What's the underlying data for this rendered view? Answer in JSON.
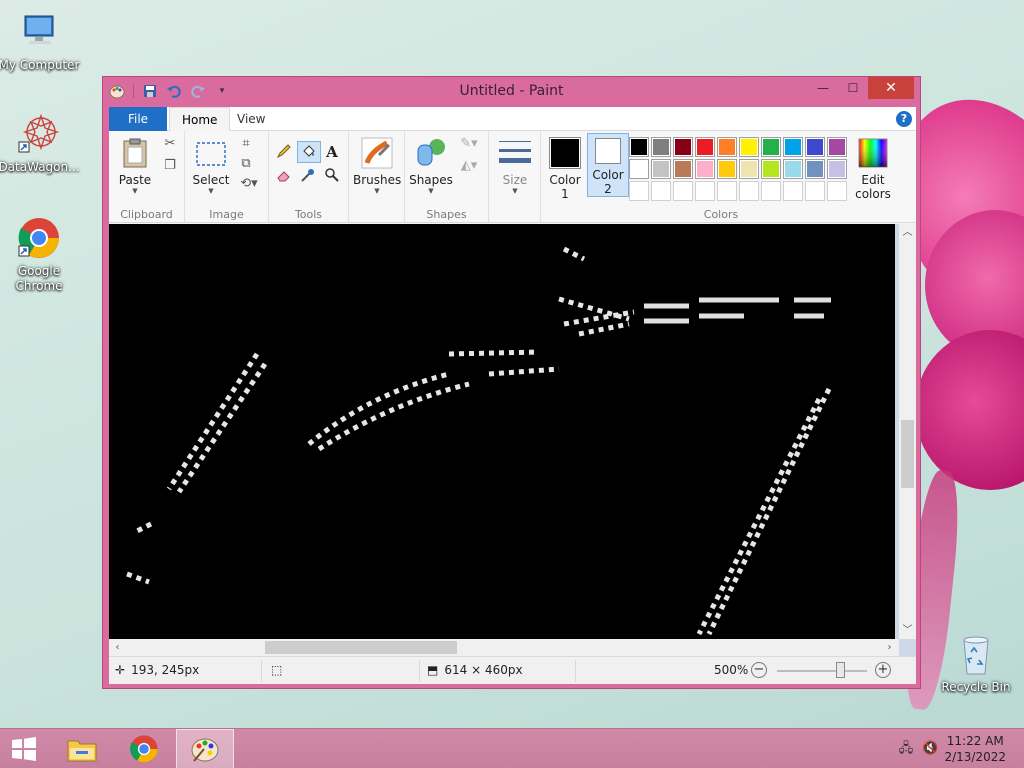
{
  "desktop": {
    "icons": [
      {
        "label": "My Computer"
      },
      {
        "label": "DataWagon..."
      },
      {
        "label": "Google Chrome"
      },
      {
        "label": "Recycle Bin"
      }
    ]
  },
  "window": {
    "title": "Untitled - Paint",
    "controls": {
      "minimize": "—",
      "maximize": "☐",
      "close": "✕"
    }
  },
  "tabs": {
    "file": "File",
    "home": "Home",
    "view": "View"
  },
  "help_glyph": "?",
  "ribbon": {
    "clipboard": {
      "label": "Clipboard",
      "paste": "Paste"
    },
    "image": {
      "label": "Image",
      "select": "Select"
    },
    "tools": {
      "label": "Tools"
    },
    "brushes": {
      "label": "Brushes"
    },
    "shapes": {
      "label": "Shapes",
      "button": "Shapes"
    },
    "size": {
      "label": "Size"
    },
    "colors": {
      "label": "Colors",
      "color1_label": "Color",
      "color1_num": "1",
      "color2_label": "Color",
      "color2_num": "2",
      "edit_line1": "Edit",
      "edit_line2": "colors",
      "color1_value": "#000000",
      "color2_value": "#ffffff",
      "palette_row1": [
        "#000000",
        "#7f7f7f",
        "#880015",
        "#ed1c24",
        "#ff7f27",
        "#fff200",
        "#22b14c",
        "#00a2e8",
        "#3f48cc",
        "#a349a4"
      ],
      "palette_row2": [
        "#ffffff",
        "#c3c3c3",
        "#b97a57",
        "#ffaec9",
        "#ffc90e",
        "#efe4b0",
        "#b5e61d",
        "#99d9ea",
        "#7092be",
        "#c8bfe7"
      ]
    }
  },
  "status": {
    "cursor_pos": "193, 245px",
    "canvas_size": "614 × 460px",
    "zoom": "500%",
    "zoom_fraction": 0.7
  },
  "taskbar": {
    "time": "11:22 AM",
    "date": "2/13/2022"
  }
}
